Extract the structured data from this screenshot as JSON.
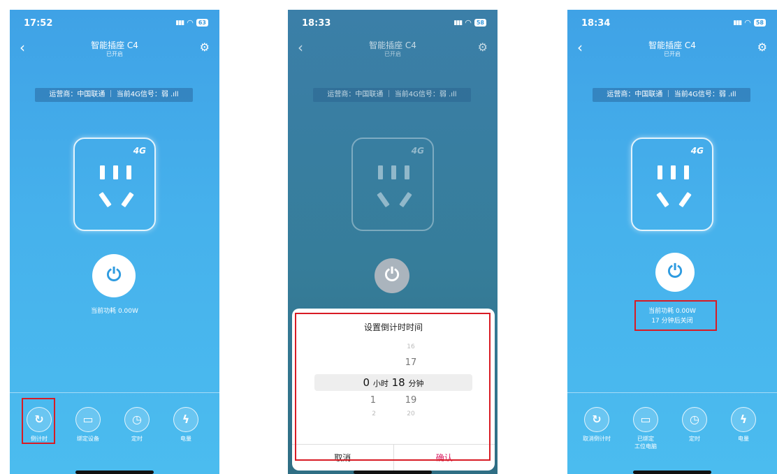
{
  "screens": [
    {
      "time": "17:52",
      "battery": "63",
      "title": "智能插座 C4",
      "subtitle": "已开启",
      "carrier": "运营商：中国联通 ｜ 当前4G信号：弱 .ıll",
      "badge_4g": "4G",
      "consumption": "当前功耗 0.00W",
      "bottom": [
        "倒计时",
        "绑定设备",
        "定时",
        "电量"
      ]
    },
    {
      "time": "18:33",
      "battery": "58",
      "title": "智能插座 C4",
      "subtitle": "已开启",
      "carrier": "运营商：中国联通 ｜ 当前4G信号：弱 .ıll",
      "badge_4g": "4G",
      "dialog": {
        "title": "设置倒计时时间",
        "hour_values": [
          "",
          "",
          "0",
          "1",
          "2"
        ],
        "hour_unit": "小时",
        "minute_values": [
          "16",
          "17",
          "18",
          "19",
          "20"
        ],
        "minute_unit": "分钟",
        "cancel": "取消",
        "confirm": "确认"
      }
    },
    {
      "time": "18:34",
      "battery": "58",
      "title": "智能插座 C4",
      "subtitle": "已开启",
      "carrier": "运营商：中国联通 ｜ 当前4G信号：弱 .ıll",
      "badge_4g": "4G",
      "consumption": "当前功耗 0.00W",
      "countdown_status": "17 分钟后关闭",
      "bottom": [
        "取消倒计时",
        "已绑定\n工位电脑",
        "定时",
        "电量"
      ]
    }
  ],
  "icons": {
    "back": "chevron-left-icon",
    "settings": "gear-icon",
    "power": "power-icon",
    "countdown": "countdown-icon",
    "device": "monitor-icon",
    "timer": "clock-icon",
    "energy": "lightning-icon"
  },
  "colors": {
    "accent": "#2e9be0",
    "highlight": "#d81b24",
    "confirm": "#d81b60"
  }
}
